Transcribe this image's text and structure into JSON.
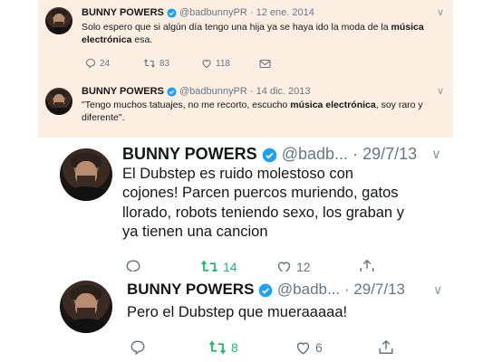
{
  "tweets": [
    {
      "name": "BUNNY POWERS",
      "handle": "@badbunnyPR",
      "separator": "·",
      "date": "12 ene. 2014",
      "text_plain": "Solo espero que si algún día tengo una hija ya se haya ido la moda de la ",
      "text_bold": "música electrónica",
      "text_end": " esa.",
      "replies": "24",
      "retweets": "83",
      "likes": "118"
    },
    {
      "name": "BUNNY POWERS",
      "handle": "@badbunnyPR",
      "separator": "·",
      "date": "14 dic. 2013",
      "text_plain": "\"Tengo muchos tatuajes, no me recorto, escucho ",
      "text_bold": "música electrónica",
      "text_end": ", soy raro y diferente\"."
    },
    {
      "name": "BUNNY POWERS",
      "handle": "@badb...",
      "separator": "·",
      "date": "29/7/13",
      "text": "El Dubstep es ruido molestoso con cojones! Parcen puercos muriendo, gatos llorado, robots teniendo sexo, los graban y ya tienen una cancion",
      "retweets": "14",
      "likes": "12"
    },
    {
      "name": "BUNNY POWERS",
      "handle": "@badb...",
      "separator": "·",
      "date": "29/7/13",
      "text": "Pero el Dubstep que muerаааaa!",
      "retweets": "8",
      "likes": "6"
    }
  ],
  "icons": {
    "reply": "reply-icon",
    "retweet": "retweet-icon",
    "like": "heart-icon",
    "dm": "mail-icon",
    "share": "share-icon",
    "verified": "verified-badge-icon",
    "chevron": "chevron-down-icon"
  },
  "colors": {
    "panel_bg": "#fcefe2",
    "verified": "#1da1f2",
    "retweet_active": "#17bf63",
    "muted": "#657786"
  }
}
